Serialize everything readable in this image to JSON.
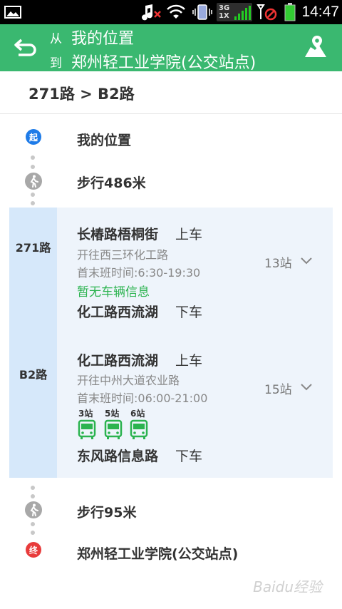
{
  "status_bar": {
    "time": "14:47",
    "network_top": "3G",
    "network_bottom": "1X"
  },
  "header": {
    "from_label": "从",
    "from_value": "我的位置",
    "to_label": "到",
    "to_value": "郑州轻工业学院(公交站点)"
  },
  "route_summary": "271路 > B2路",
  "steps": {
    "start_marker": "起",
    "start_label": "我的位置",
    "walk1": "步行486米",
    "walk2": "步行95米",
    "end_marker": "终",
    "end_label": "郑州轻工业学院(公交站点)"
  },
  "rides": [
    {
      "line": "271路",
      "board_stop": "长椿路梧桐街",
      "board_action": "上车",
      "direction": "开往西三环化工路",
      "schedule": "首末班时间:6:30-19:30",
      "realtime": "暂无车辆信息",
      "stop_count": "13站",
      "alight_stop": "化工路西流湖",
      "alight_action": "下车"
    },
    {
      "line": "B2路",
      "board_stop": "化工路西流湖",
      "board_action": "上车",
      "direction": "开往中州大道农业路",
      "schedule": "首末班时间:06:00-21:00",
      "stop_count": "15站",
      "buses": [
        "3站",
        "5站",
        "6站"
      ],
      "alight_stop": "东风路信息路",
      "alight_action": "下车"
    }
  ],
  "colors": {
    "header_green": "#3ab870",
    "realtime_green": "#2bb34f",
    "start_marker": "#1e7be8",
    "end_marker": "#e83b3b",
    "ride_bg": "#eef4fb",
    "line_col_bg": "#d6e8fa"
  },
  "watermark": "Baidu经验"
}
